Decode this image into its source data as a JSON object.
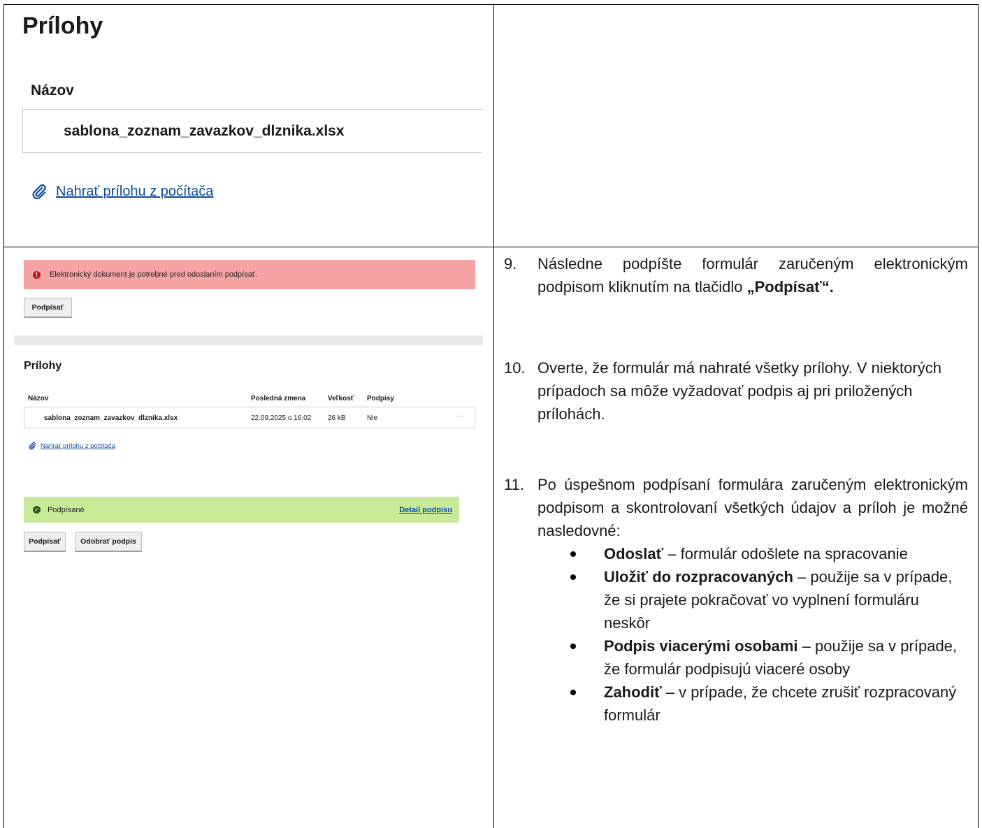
{
  "top_left": {
    "title": "Prílohy",
    "column_label": "Názov",
    "file_name": "sablona_zoznam_zavazkov_dlznika.xlsx",
    "upload_link": "Nahrať prílohu z počítača"
  },
  "bottom_left": {
    "error_text": "Elektronický dokument je potrebné pred odoslaním podpísať.",
    "sign_button": "Podpísať",
    "section_title": "Prílohy",
    "table": {
      "headers": [
        "Názov",
        "Posledná zmena",
        "Veľkosť",
        "Podpisy"
      ],
      "row": {
        "name": "sablona_zoznam_zavazkov_dlznika.xlsx",
        "modified": "22.09.2025 o 16:02",
        "size": "26 kB",
        "signatures": "Nie",
        "menu": "···"
      }
    },
    "upload_link": "Nahrať prílohu z počítača",
    "success_text": "Podpísané",
    "detail_link": "Detail podpisu",
    "sign_button_2": "Podpísať",
    "remove_sign_button": "Odobrať podpis"
  },
  "right": {
    "step9": {
      "num": "9.",
      "text_before": "Následne podpíšte formulár zaručeným elektronickým podpisom kliknutím na tlačidlo ",
      "bold": "„Podpísať“."
    },
    "step10": {
      "num": "10.",
      "text": "Overte, že formulár má nahraté všetky prílohy. V niektorých prípadoch sa môže vyžadovať podpis aj pri priložených prílohách."
    },
    "step11": {
      "num": "11.",
      "text": "Po úspešnom podpísaní formulára zaručeným elektronickým podpisom a skontrolovaní všetkých údajov a príloh je možné nasledovné:"
    },
    "bullets": [
      {
        "bold": "Odoslať",
        "text": " – formulár odošlete na spracovanie"
      },
      {
        "bold": "Uložiť do rozpracovaných",
        "text": " – použije sa v prípade, že si prajete pokračovať vo vyplnení formuláru neskôr"
      },
      {
        "bold": "Podpis viacerými osobami",
        "text": " – použije sa v prípade, že formulár podpisujú viaceré osoby"
      },
      {
        "bold": "Zahodiť",
        "text": " – v prípade, že chcete zrušiť rozpracovaný formulár"
      }
    ]
  },
  "icons": {
    "paperclip": "paperclip-icon",
    "error": "error-icon",
    "success": "check-icon"
  },
  "colors": {
    "link": "#0b4a9e",
    "error_banner": "#f5a3a3",
    "success_banner": "#c8eb97"
  }
}
